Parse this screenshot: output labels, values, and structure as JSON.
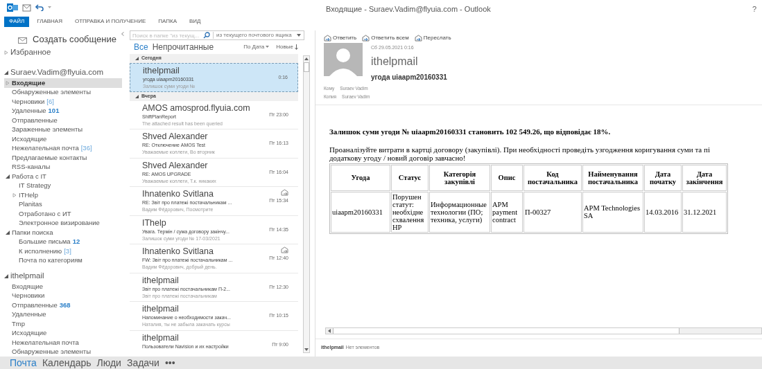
{
  "window": {
    "title": "Входящие - Suraev.Vadim@flyuia.com - Outlook",
    "help": "?"
  },
  "ribbon_tabs": [
    {
      "label": "ФАЙЛ",
      "selected": true
    },
    {
      "label": "ГЛАВНАЯ",
      "selected": false
    },
    {
      "label": "ОТПРАВКА И ПОЛУЧЕНИЕ",
      "selected": false
    },
    {
      "label": "ПАПКА",
      "selected": false
    },
    {
      "label": "ВИД",
      "selected": false
    }
  ],
  "new_message": "Создать сообщение",
  "folders": [
    {
      "label": "Избранное",
      "expanded": false,
      "selected": false
    },
    {
      "label": "Suraev.Vadim@flyuia.com",
      "expanded": true,
      "selected": false,
      "children": [
        {
          "label": "Входящие",
          "selected": true,
          "expanded": false
        },
        {
          "label": "Обнаруженные элементы",
          "selected": false
        },
        {
          "label": "Черновики",
          "count": "[6]",
          "count_bold": false,
          "selected": false
        },
        {
          "label": "Удаленные",
          "count": "101",
          "count_bold": true,
          "selected": false
        },
        {
          "label": "Отправленные",
          "selected": false
        },
        {
          "label": "Зараженные элементы",
          "selected": false
        },
        {
          "label": "Исходящие",
          "selected": false
        },
        {
          "label": "Нежелательная почта",
          "count": "[36]",
          "count_bold": false,
          "selected": false
        },
        {
          "label": "Предлагаемые контакты",
          "selected": false
        },
        {
          "label": "RSS-каналы",
          "selected": false
        },
        {
          "label": "Работа с IT",
          "expanded": true,
          "selected": false,
          "children": [
            {
              "label": "IT Strategy",
              "selected": false
            },
            {
              "label": "ITHelp",
              "expanded": false,
              "selected": false
            },
            {
              "label": "Planitas",
              "selected": false
            },
            {
              "label": "Отработано с ИТ",
              "selected": false
            },
            {
              "label": "Электронное визирование",
              "selected": false
            }
          ]
        },
        {
          "label": "Папки поиска",
          "expanded": true,
          "selected": false,
          "children": [
            {
              "label": "Большие письма",
              "count": "12",
              "count_bold": true,
              "selected": false
            },
            {
              "label": "К исполнению",
              "count": "[3]",
              "count_bold": false,
              "selected": false
            },
            {
              "label": "Почта по категориям",
              "selected": false
            }
          ]
        }
      ]
    },
    {
      "label": "ithelpmail",
      "expanded": true,
      "selected": false,
      "children": [
        {
          "label": "Входящие",
          "selected": false
        },
        {
          "label": "Черновики",
          "selected": false
        },
        {
          "label": "Отправленные",
          "count": "368",
          "count_bold": true,
          "selected": false
        },
        {
          "label": "Удаленные",
          "selected": false
        },
        {
          "label": "Tmp",
          "selected": false
        },
        {
          "label": "Исходящие",
          "selected": false
        },
        {
          "label": "Нежелательная почта",
          "selected": false
        },
        {
          "label": "Обнаруженные элементы",
          "selected": false
        }
      ]
    }
  ],
  "search": {
    "placeholder": "Поиск в папке \"из текущ...",
    "scope": "из текущего почтового ящика"
  },
  "list_filters": [
    {
      "label": "Все",
      "selected": true
    },
    {
      "label": "Непрочитанные",
      "selected": false
    }
  ],
  "sort": {
    "by": "По Дата",
    "order": "Новые"
  },
  "message_groups": [
    {
      "label": "Сегодня",
      "messages": [
        {
          "sender": "ithelpmail",
          "subject": "угода uiaapm20160331",
          "preview": "Залишок суми угоди №",
          "time": "0:16",
          "selected": true,
          "replied": false
        }
      ]
    },
    {
      "label": "Вчера",
      "messages": [
        {
          "sender": "AMOS amosprod.flyuia.com",
          "subject": "ShiftPlanReport",
          "preview": "The attached result has been queried",
          "time": "Пт 23:00",
          "selected": false,
          "replied": false
        },
        {
          "sender": "Shved Alexander",
          "subject": "RE: Отключение AMOS Test",
          "preview": "Уважаемые коллеги,  Во вторник",
          "time": "Пт 16:13",
          "selected": false,
          "replied": false
        },
        {
          "sender": "Shved Alexander",
          "subject": "RE: AMOS UPGRADE",
          "preview": "Уважаемые коллеги,  Т.к. никаких",
          "time": "Пт 16:04",
          "selected": false,
          "replied": false
        },
        {
          "sender": "Ihnatenko Svitlana",
          "subject": "RE: Звіт про платежі постачальникам ...",
          "preview": "Вадим Фёдорович,  Посмотрите",
          "time": "Пт 15:34",
          "selected": false,
          "replied": true
        },
        {
          "sender": "IThelp",
          "subject": "Увага. Термін / сума договору закінчу...",
          "preview": "Залишок суми угоди № 17-03/2021",
          "time": "Пт 14:35",
          "selected": false,
          "replied": false
        },
        {
          "sender": "Ihnatenko Svitlana",
          "subject": "FW: Звіт про платежі постачальникам ...",
          "preview": "Вадим Фёдорович, добрый день.",
          "time": "Пт 12:40",
          "selected": false,
          "replied": true
        },
        {
          "sender": "ithelpmail",
          "subject": "Звіт про платежі постачальникам  П-2...",
          "preview": "Звіт про платежі постачальникам",
          "time": "Пт 12:30",
          "selected": false,
          "replied": false
        },
        {
          "sender": "ithelpmail",
          "subject": "Напоминание о необходимости закач...",
          "preview": "Наталия,  ты не забыла закачать курсы",
          "time": "Пт 10:15",
          "selected": false,
          "replied": false
        },
        {
          "sender": "ithelpmail",
          "subject": "Пользователи Navision и их настройки",
          "time": "Пт 9:00",
          "selected": false,
          "replied": false
        }
      ]
    }
  ],
  "reading_actions": [
    "Ответить",
    "Ответить всем",
    "Переслать"
  ],
  "message": {
    "date": "Сб 29.05.2021 0:16",
    "sender": "ithelpmail",
    "subject": "угода uiaapm20160331",
    "recipients": [
      {
        "label": "Кому",
        "name": "Suraev Vadim"
      },
      {
        "label": "Копия",
        "name": "Suraev Vadim"
      }
    ],
    "headline": "Залишок суми угоди № uiaapm20160331 становить 102 549.26, що відповідає 18%.",
    "paragraph": [
      "Проаналізуйте витрати в картці договору (закупівлі). При необхідності проведіть узгодження коригування суми та пі",
      "додаткову угоду / новий договір завчасно!"
    ],
    "table": {
      "columns": [
        "Угода",
        "Статус",
        "Категорія закупівлі",
        "Опис",
        "Код постачальника",
        "Найменування постачальника",
        "Дата початку",
        "Дата закінчення"
      ],
      "rows": [
        [
          "uiaapm20160331",
          "Порушен статут: необхідне схвалення HP",
          "Информационные технологии (ПО; техника, услуги)",
          "APM payment contract",
          "П-00327",
          "APM Technologies SA",
          "14.03.2016",
          "31.12.2021"
        ]
      ]
    }
  },
  "people_pane": {
    "account": "ithelpmail",
    "text": "Нет элементов"
  },
  "nav": [
    {
      "label": "Почта",
      "selected": true
    },
    {
      "label": "Календарь",
      "selected": false
    },
    {
      "label": "Люди",
      "selected": false
    },
    {
      "label": "Задачи",
      "selected": false
    },
    {
      "label": "•••",
      "selected": false
    }
  ]
}
